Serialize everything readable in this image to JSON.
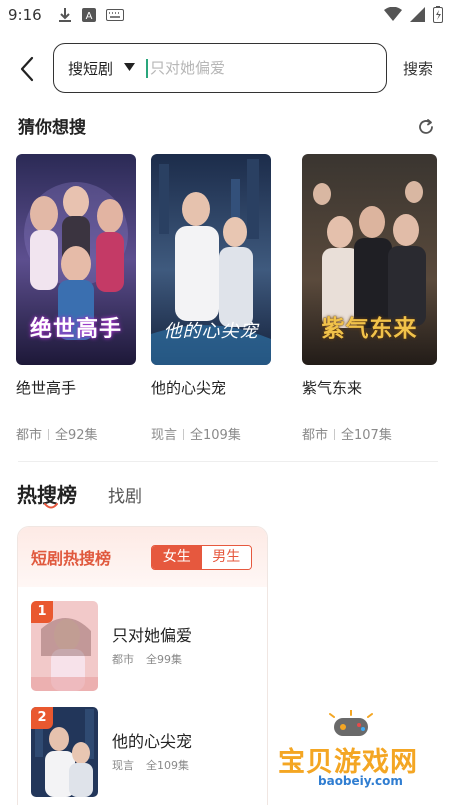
{
  "status_bar": {
    "time": "9:16"
  },
  "search": {
    "type_label": "搜短剧",
    "placeholder": "只对她偏爱",
    "button_label": "搜索"
  },
  "guess": {
    "title": "猜你想搜",
    "items": [
      {
        "title": "绝世高手",
        "poster_text": "绝世高手",
        "genre": "都市",
        "episodes": "全92集"
      },
      {
        "title": "他的心尖宠",
        "poster_text": "他的心尖宠",
        "genre": "现言",
        "episodes": "全109集"
      },
      {
        "title": "紫气东来",
        "poster_text": "紫气东来",
        "genre": "都市",
        "episodes": "全107集"
      }
    ]
  },
  "tabs": {
    "hot": "热搜榜",
    "find": "找剧"
  },
  "ranking": {
    "title": "短剧热搜榜",
    "female": "女生",
    "male": "男生",
    "items": [
      {
        "rank": "1",
        "title": "只对她偏爱",
        "genre": "都市",
        "episodes": "全99集"
      },
      {
        "rank": "2",
        "title": "他的心尖宠",
        "genre": "现言",
        "episodes": "全109集"
      }
    ]
  },
  "watermark": {
    "text": "宝贝游戏网",
    "url": "baobeiy.com"
  },
  "colors": {
    "accent": "#e6583e",
    "cursor": "#2aa67c",
    "meta": "#8a8a8a"
  }
}
